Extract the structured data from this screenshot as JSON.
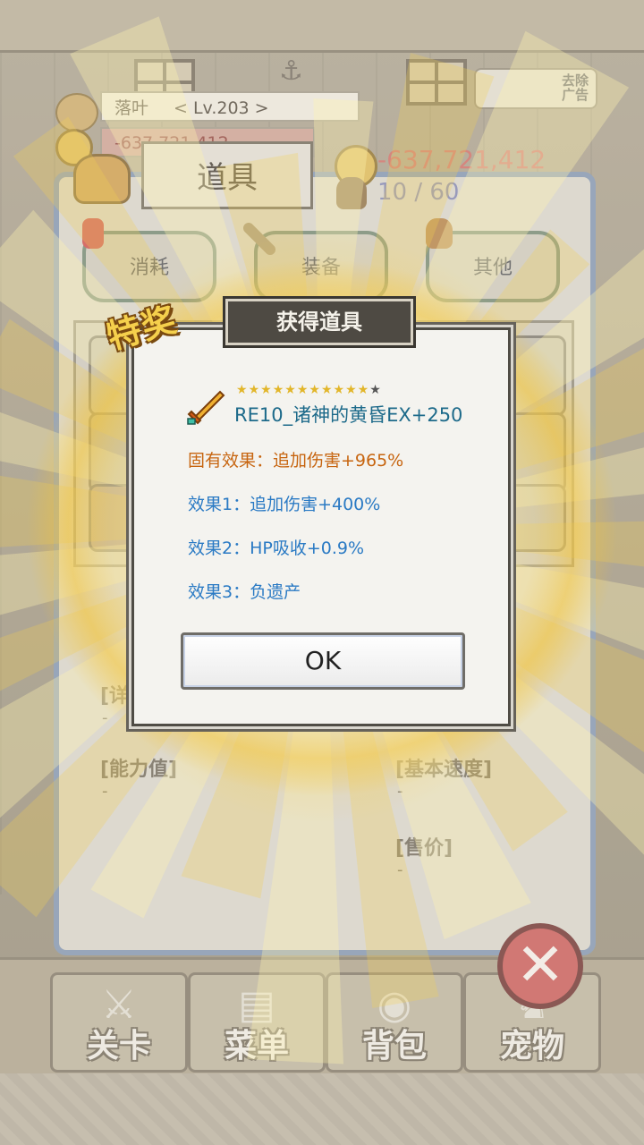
{
  "player": {
    "name": "落叶",
    "level": "< Lv.203 >",
    "gold_small": "-637,721,412"
  },
  "inventory": {
    "title": "道具",
    "gold": "-637,721,412",
    "slots": "10 / 60",
    "tabs": [
      {
        "label": "消耗"
      },
      {
        "label": "装备"
      },
      {
        "label": "其他"
      }
    ],
    "info_labels": {
      "detail": "[详",
      "ability": "[能力值]",
      "speed": "[基本速度]",
      "price": "[售价]"
    },
    "dash": "-"
  },
  "top_right": {
    "ads_label": "去除\n广告"
  },
  "nav": [
    {
      "label": "关卡",
      "icon": "crossed-swords-icon"
    },
    {
      "label": "菜单",
      "icon": "book-icon"
    },
    {
      "label": "背包",
      "icon": "backpack-icon"
    },
    {
      "label": "宠物",
      "icon": "pet-icon"
    }
  ],
  "dialog": {
    "title": "获得道具",
    "badge": "特奖",
    "stars_filled": 11,
    "stars_total": 12,
    "item_name": "RE10_诸神的黄昏EX+250",
    "base_effect": "固有效果：追加伤害+965%",
    "effects": [
      "效果1：追加伤害+400%",
      "效果2：HP吸收+0.9%",
      "效果3：负遗产"
    ],
    "ok_label": "OK"
  },
  "colors": {
    "accent_gold": "#f5d04c",
    "item_name": "#1d6a8a",
    "base_effect": "#c76510",
    "effect": "#2a7ac4",
    "gold_value": "#c9645a"
  }
}
